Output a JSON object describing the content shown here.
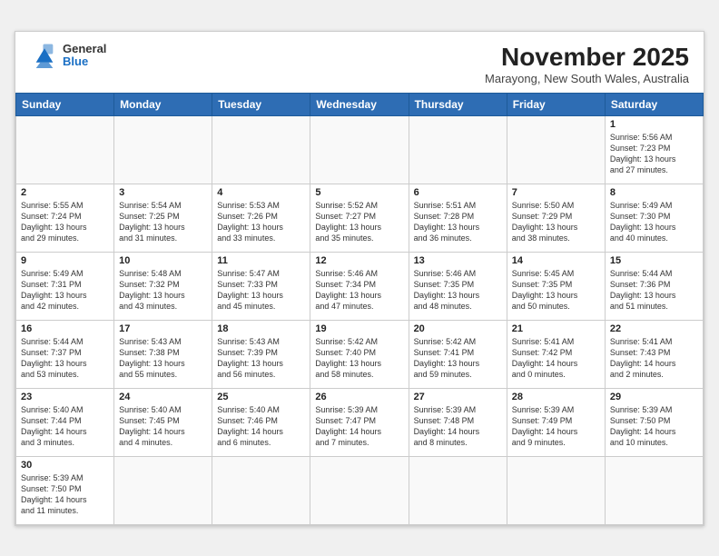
{
  "header": {
    "logo_general": "General",
    "logo_blue": "Blue",
    "month_title": "November 2025",
    "location": "Marayong, New South Wales, Australia"
  },
  "weekdays": [
    "Sunday",
    "Monday",
    "Tuesday",
    "Wednesday",
    "Thursday",
    "Friday",
    "Saturday"
  ],
  "weeks": [
    [
      {
        "day": null,
        "info": null
      },
      {
        "day": null,
        "info": null
      },
      {
        "day": null,
        "info": null
      },
      {
        "day": null,
        "info": null
      },
      {
        "day": null,
        "info": null
      },
      {
        "day": null,
        "info": null
      },
      {
        "day": "1",
        "info": "Sunrise: 5:56 AM\nSunset: 7:23 PM\nDaylight: 13 hours\nand 27 minutes."
      }
    ],
    [
      {
        "day": "2",
        "info": "Sunrise: 5:55 AM\nSunset: 7:24 PM\nDaylight: 13 hours\nand 29 minutes."
      },
      {
        "day": "3",
        "info": "Sunrise: 5:54 AM\nSunset: 7:25 PM\nDaylight: 13 hours\nand 31 minutes."
      },
      {
        "day": "4",
        "info": "Sunrise: 5:53 AM\nSunset: 7:26 PM\nDaylight: 13 hours\nand 33 minutes."
      },
      {
        "day": "5",
        "info": "Sunrise: 5:52 AM\nSunset: 7:27 PM\nDaylight: 13 hours\nand 35 minutes."
      },
      {
        "day": "6",
        "info": "Sunrise: 5:51 AM\nSunset: 7:28 PM\nDaylight: 13 hours\nand 36 minutes."
      },
      {
        "day": "7",
        "info": "Sunrise: 5:50 AM\nSunset: 7:29 PM\nDaylight: 13 hours\nand 38 minutes."
      },
      {
        "day": "8",
        "info": "Sunrise: 5:49 AM\nSunset: 7:30 PM\nDaylight: 13 hours\nand 40 minutes."
      }
    ],
    [
      {
        "day": "9",
        "info": "Sunrise: 5:49 AM\nSunset: 7:31 PM\nDaylight: 13 hours\nand 42 minutes."
      },
      {
        "day": "10",
        "info": "Sunrise: 5:48 AM\nSunset: 7:32 PM\nDaylight: 13 hours\nand 43 minutes."
      },
      {
        "day": "11",
        "info": "Sunrise: 5:47 AM\nSunset: 7:33 PM\nDaylight: 13 hours\nand 45 minutes."
      },
      {
        "day": "12",
        "info": "Sunrise: 5:46 AM\nSunset: 7:34 PM\nDaylight: 13 hours\nand 47 minutes."
      },
      {
        "day": "13",
        "info": "Sunrise: 5:46 AM\nSunset: 7:35 PM\nDaylight: 13 hours\nand 48 minutes."
      },
      {
        "day": "14",
        "info": "Sunrise: 5:45 AM\nSunset: 7:35 PM\nDaylight: 13 hours\nand 50 minutes."
      },
      {
        "day": "15",
        "info": "Sunrise: 5:44 AM\nSunset: 7:36 PM\nDaylight: 13 hours\nand 51 minutes."
      }
    ],
    [
      {
        "day": "16",
        "info": "Sunrise: 5:44 AM\nSunset: 7:37 PM\nDaylight: 13 hours\nand 53 minutes."
      },
      {
        "day": "17",
        "info": "Sunrise: 5:43 AM\nSunset: 7:38 PM\nDaylight: 13 hours\nand 55 minutes."
      },
      {
        "day": "18",
        "info": "Sunrise: 5:43 AM\nSunset: 7:39 PM\nDaylight: 13 hours\nand 56 minutes."
      },
      {
        "day": "19",
        "info": "Sunrise: 5:42 AM\nSunset: 7:40 PM\nDaylight: 13 hours\nand 58 minutes."
      },
      {
        "day": "20",
        "info": "Sunrise: 5:42 AM\nSunset: 7:41 PM\nDaylight: 13 hours\nand 59 minutes."
      },
      {
        "day": "21",
        "info": "Sunrise: 5:41 AM\nSunset: 7:42 PM\nDaylight: 14 hours\nand 0 minutes."
      },
      {
        "day": "22",
        "info": "Sunrise: 5:41 AM\nSunset: 7:43 PM\nDaylight: 14 hours\nand 2 minutes."
      }
    ],
    [
      {
        "day": "23",
        "info": "Sunrise: 5:40 AM\nSunset: 7:44 PM\nDaylight: 14 hours\nand 3 minutes."
      },
      {
        "day": "24",
        "info": "Sunrise: 5:40 AM\nSunset: 7:45 PM\nDaylight: 14 hours\nand 4 minutes."
      },
      {
        "day": "25",
        "info": "Sunrise: 5:40 AM\nSunset: 7:46 PM\nDaylight: 14 hours\nand 6 minutes."
      },
      {
        "day": "26",
        "info": "Sunrise: 5:39 AM\nSunset: 7:47 PM\nDaylight: 14 hours\nand 7 minutes."
      },
      {
        "day": "27",
        "info": "Sunrise: 5:39 AM\nSunset: 7:48 PM\nDaylight: 14 hours\nand 8 minutes."
      },
      {
        "day": "28",
        "info": "Sunrise: 5:39 AM\nSunset: 7:49 PM\nDaylight: 14 hours\nand 9 minutes."
      },
      {
        "day": "29",
        "info": "Sunrise: 5:39 AM\nSunset: 7:50 PM\nDaylight: 14 hours\nand 10 minutes."
      }
    ],
    [
      {
        "day": "30",
        "info": "Sunrise: 5:39 AM\nSunset: 7:50 PM\nDaylight: 14 hours\nand 11 minutes."
      },
      {
        "day": null,
        "info": null
      },
      {
        "day": null,
        "info": null
      },
      {
        "day": null,
        "info": null
      },
      {
        "day": null,
        "info": null
      },
      {
        "day": null,
        "info": null
      },
      {
        "day": null,
        "info": null
      }
    ]
  ]
}
